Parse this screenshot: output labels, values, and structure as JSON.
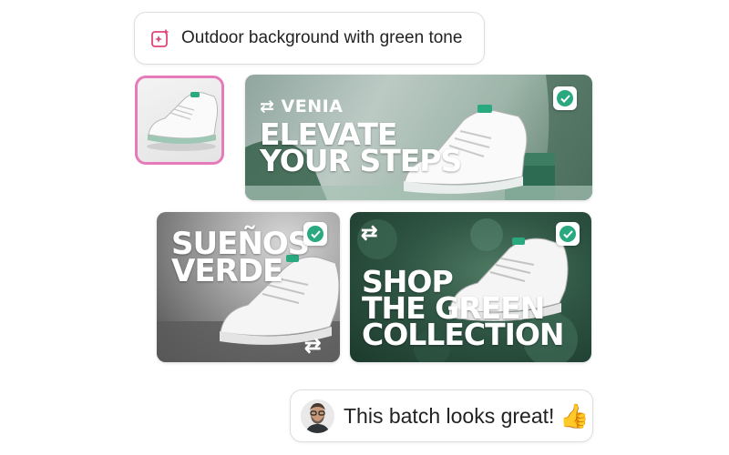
{
  "prompt": {
    "text": "Outdoor background with green tone",
    "icon": "sparkle-image-icon"
  },
  "cards": [
    {
      "brand": "VENIA",
      "headline_line1": "ELEVATE",
      "headline_line2": "YOUR STEPS",
      "selected": true
    },
    {
      "headline_line1": "SUEÑOS",
      "headline_line2": "VERDE",
      "selected": true
    },
    {
      "headline_line1": "SHOP",
      "headline_line2": "THE GREEN",
      "headline_line3": "COLLECTION",
      "selected": true
    }
  ],
  "reply": {
    "text": "This batch looks great!",
    "emoji": "👍"
  },
  "colors": {
    "accent_green": "#2aa981",
    "thumb_border": "#e67bb9",
    "prompt_icon": "#e0457a"
  }
}
